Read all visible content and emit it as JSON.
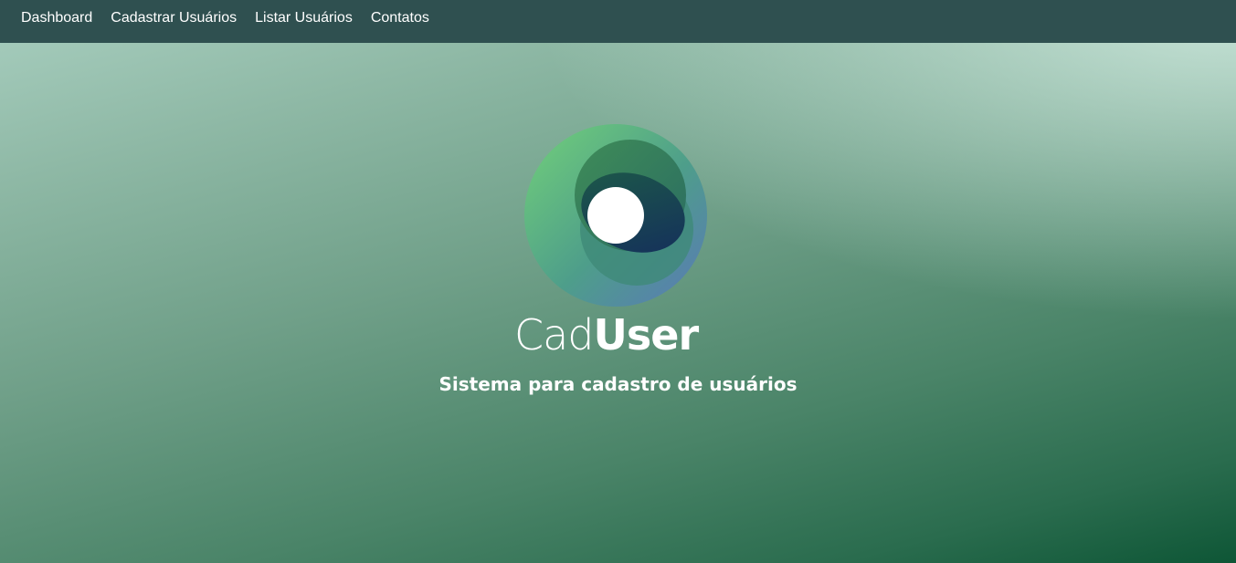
{
  "nav": {
    "items": [
      {
        "label": "Dashboard"
      },
      {
        "label": "Cadastrar Usuários"
      },
      {
        "label": "Listar Usuários"
      },
      {
        "label": "Contatos"
      }
    ]
  },
  "hero": {
    "logo_icon": "caduser-logo-icon",
    "logo_text_light": "Cad",
    "logo_text_bold": "User",
    "tagline": "Sistema para cadastro de usuários"
  },
  "colors": {
    "navbar": "#2f5050",
    "text": "#ffffff",
    "logo_green": "#6fcf7a",
    "logo_blue": "#4f7fb4",
    "logo_dark": "#163e52"
  }
}
